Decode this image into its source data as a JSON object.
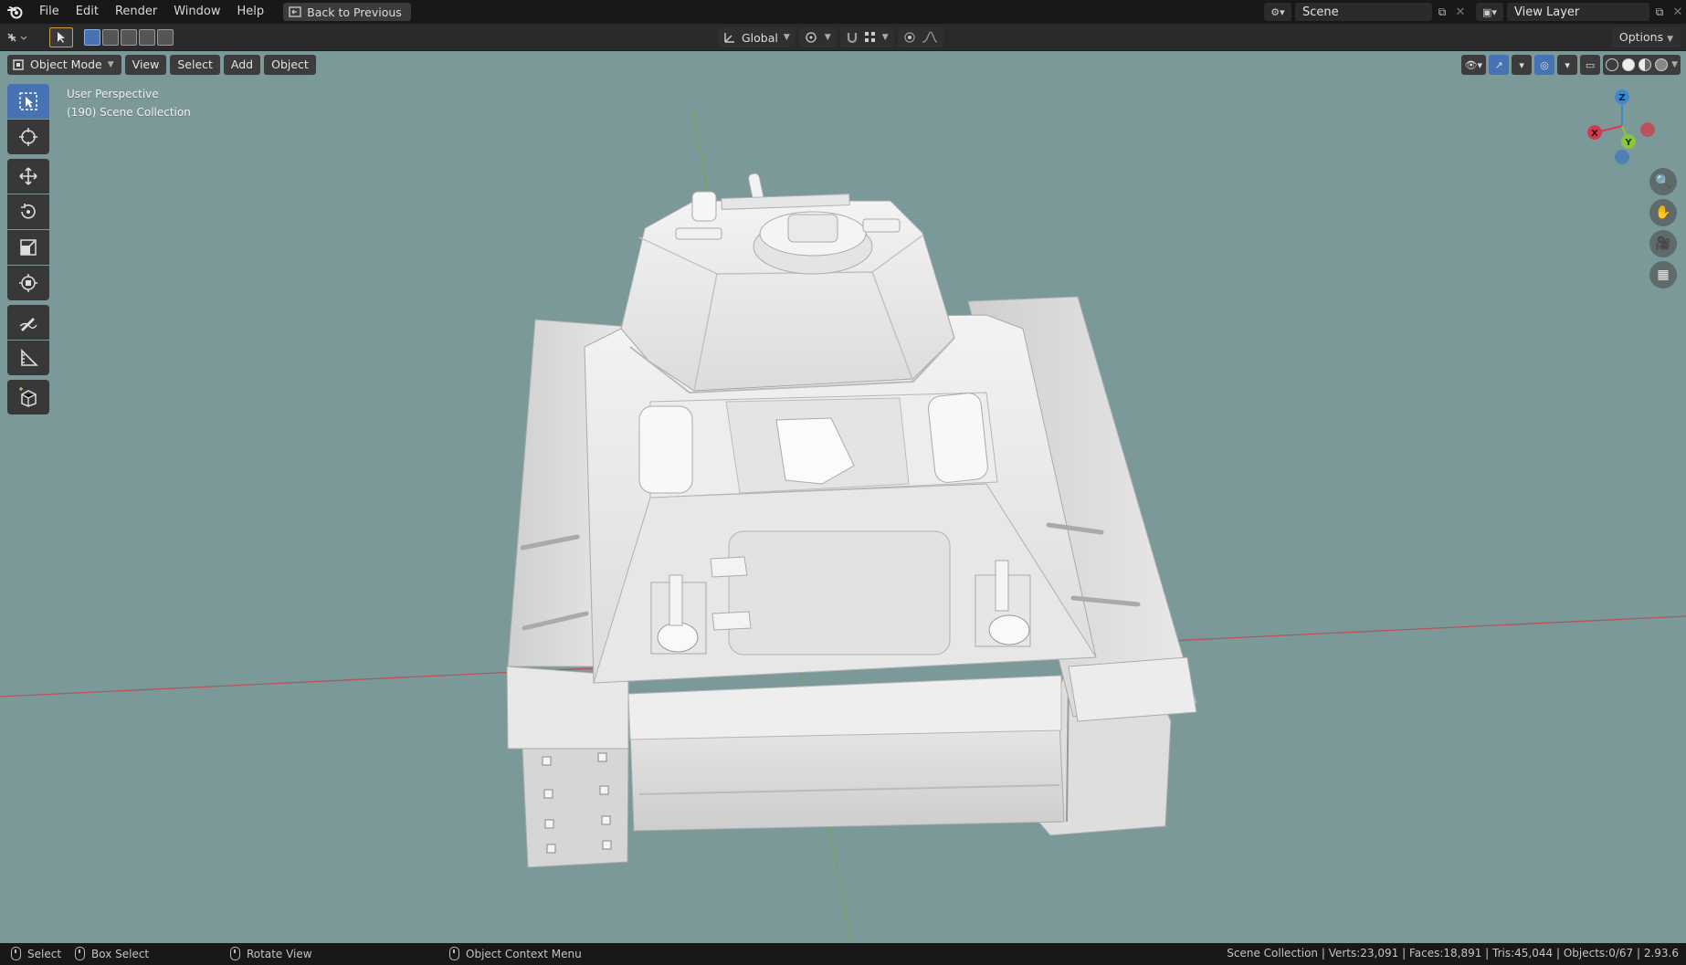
{
  "menu": {
    "items": [
      "File",
      "Edit",
      "Render",
      "Window",
      "Help"
    ],
    "back_button": "Back to Previous"
  },
  "scene": {
    "name": "Scene"
  },
  "view_layer": {
    "name": "View Layer"
  },
  "header": {
    "transform_orientation": "Global",
    "options_label": "Options"
  },
  "viewport": {
    "mode": "Object Mode",
    "menus": [
      "View",
      "Select",
      "Add",
      "Object"
    ],
    "overlay_line1": "User Perspective",
    "overlay_line2": "(190) Scene Collection",
    "gizmo": {
      "x": "X",
      "y": "Y",
      "z": "Z"
    },
    "background_color": "#7c9999"
  },
  "toolbar": {
    "tools": [
      "select-box",
      "cursor",
      "move",
      "rotate",
      "scale",
      "transform",
      "annotate",
      "measure",
      "add-cube"
    ],
    "active": "select-box"
  },
  "status": {
    "select": "Select",
    "box_select": "Box Select",
    "rotate_view": "Rotate View",
    "context_menu": "Object Context Menu",
    "stats": "Scene Collection | Verts:23,091 | Faces:18,891 | Tris:45,044 | Objects:0/67 | 2.93.6"
  },
  "colors": {
    "accent": "#4772b3",
    "x_axis": "#d4394f",
    "y_axis": "#8ac53e",
    "z_axis": "#3d88cf"
  }
}
